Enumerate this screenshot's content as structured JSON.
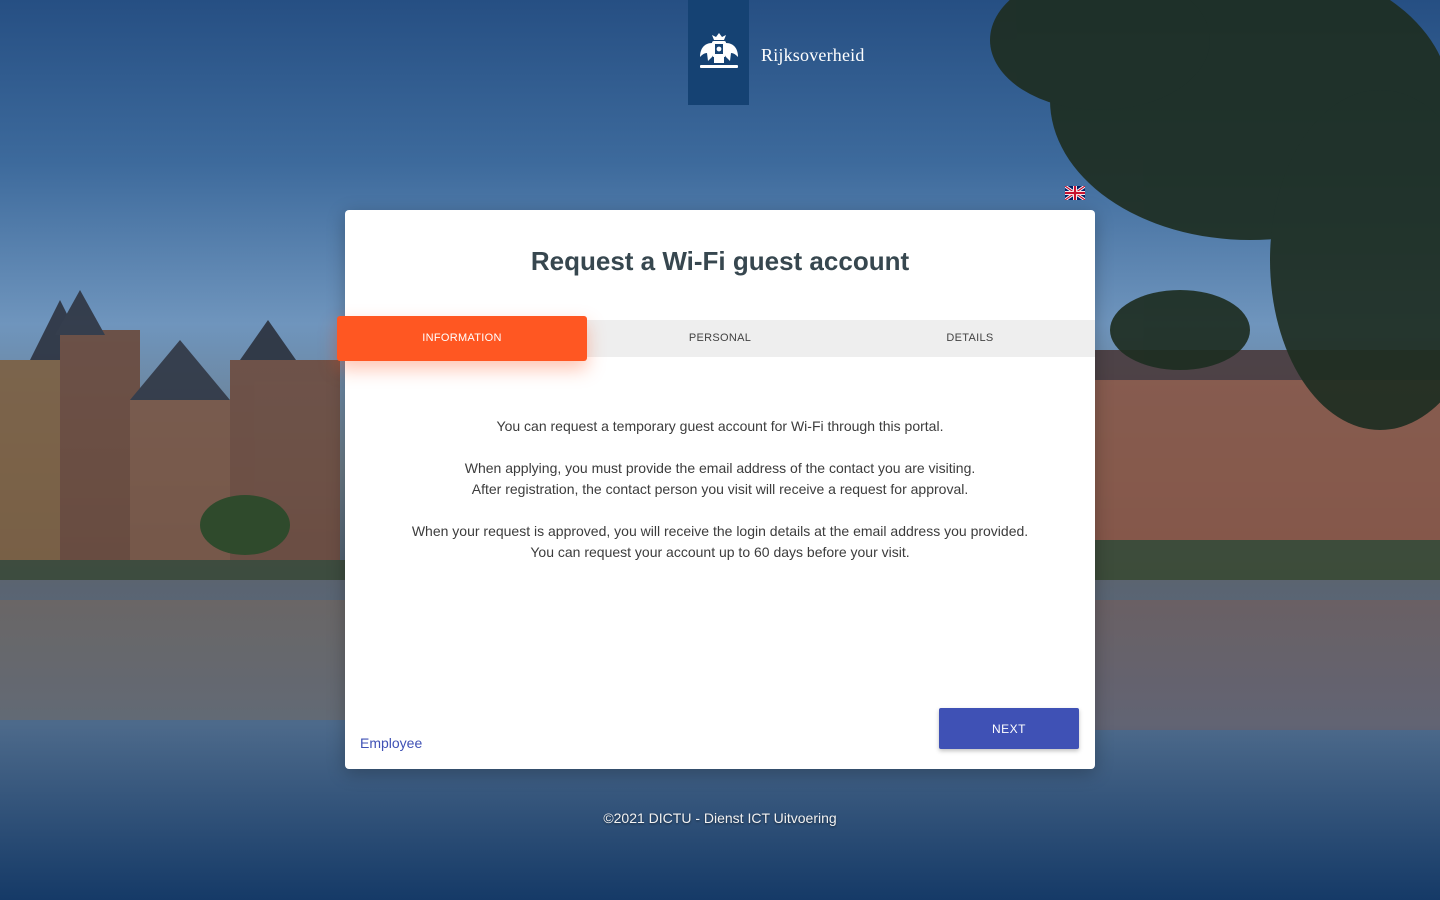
{
  "brand": {
    "name": "Rijksoverheid",
    "logo_icon": "royal-coat-of-arms-icon",
    "color": "#154273"
  },
  "language": {
    "selected_icon": "uk-flag-icon"
  },
  "card": {
    "title": "Request a Wi-Fi guest account",
    "tabs": [
      {
        "label": "INFORMATION",
        "active": true
      },
      {
        "label": "PERSONAL",
        "active": false
      },
      {
        "label": "DETAILS",
        "active": false
      }
    ],
    "paragraphs": [
      {
        "lines": [
          "You can request a temporary guest account for Wi-Fi through this portal."
        ]
      },
      {
        "lines": [
          "When applying, you must provide the email address of the contact you are visiting.",
          "After registration, the contact person you visit will receive a request for approval."
        ]
      },
      {
        "lines": [
          "When your request is approved, you will receive the login details at the email address you provided.",
          "You can request your account up to 60 days before your visit."
        ]
      }
    ],
    "employee_link": "Employee",
    "next_button": "NEXT"
  },
  "footer": {
    "copyright": "©2021 DICTU - Dienst ICT Uitvoering"
  },
  "colors": {
    "accent_active_tab": "#ff5722",
    "primary_button": "#3f51b5",
    "link": "#3f51b5"
  }
}
